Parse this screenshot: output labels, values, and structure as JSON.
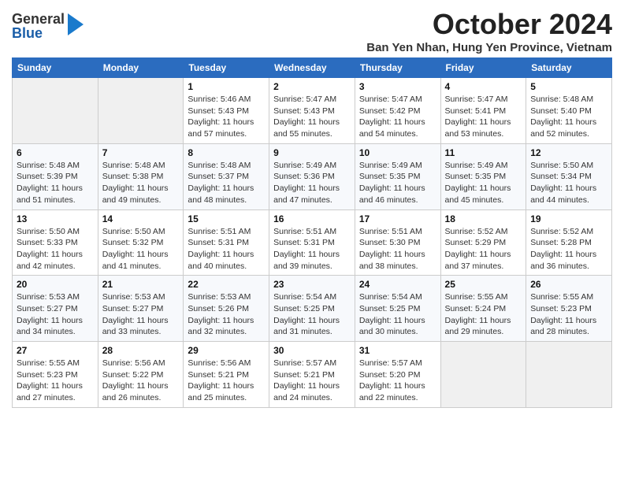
{
  "header": {
    "logo_general": "General",
    "logo_blue": "Blue",
    "month_title": "October 2024",
    "location": "Ban Yen Nhan, Hung Yen Province, Vietnam"
  },
  "days_of_week": [
    "Sunday",
    "Monday",
    "Tuesday",
    "Wednesday",
    "Thursday",
    "Friday",
    "Saturday"
  ],
  "weeks": [
    [
      {
        "day": "",
        "info": ""
      },
      {
        "day": "",
        "info": ""
      },
      {
        "day": "1",
        "sunrise": "5:46 AM",
        "sunset": "5:43 PM",
        "daylight": "11 hours and 57 minutes."
      },
      {
        "day": "2",
        "sunrise": "5:47 AM",
        "sunset": "5:43 PM",
        "daylight": "11 hours and 55 minutes."
      },
      {
        "day": "3",
        "sunrise": "5:47 AM",
        "sunset": "5:42 PM",
        "daylight": "11 hours and 54 minutes."
      },
      {
        "day": "4",
        "sunrise": "5:47 AM",
        "sunset": "5:41 PM",
        "daylight": "11 hours and 53 minutes."
      },
      {
        "day": "5",
        "sunrise": "5:48 AM",
        "sunset": "5:40 PM",
        "daylight": "11 hours and 52 minutes."
      }
    ],
    [
      {
        "day": "6",
        "sunrise": "5:48 AM",
        "sunset": "5:39 PM",
        "daylight": "11 hours and 51 minutes."
      },
      {
        "day": "7",
        "sunrise": "5:48 AM",
        "sunset": "5:38 PM",
        "daylight": "11 hours and 49 minutes."
      },
      {
        "day": "8",
        "sunrise": "5:48 AM",
        "sunset": "5:37 PM",
        "daylight": "11 hours and 48 minutes."
      },
      {
        "day": "9",
        "sunrise": "5:49 AM",
        "sunset": "5:36 PM",
        "daylight": "11 hours and 47 minutes."
      },
      {
        "day": "10",
        "sunrise": "5:49 AM",
        "sunset": "5:35 PM",
        "daylight": "11 hours and 46 minutes."
      },
      {
        "day": "11",
        "sunrise": "5:49 AM",
        "sunset": "5:35 PM",
        "daylight": "11 hours and 45 minutes."
      },
      {
        "day": "12",
        "sunrise": "5:50 AM",
        "sunset": "5:34 PM",
        "daylight": "11 hours and 44 minutes."
      }
    ],
    [
      {
        "day": "13",
        "sunrise": "5:50 AM",
        "sunset": "5:33 PM",
        "daylight": "11 hours and 42 minutes."
      },
      {
        "day": "14",
        "sunrise": "5:50 AM",
        "sunset": "5:32 PM",
        "daylight": "11 hours and 41 minutes."
      },
      {
        "day": "15",
        "sunrise": "5:51 AM",
        "sunset": "5:31 PM",
        "daylight": "11 hours and 40 minutes."
      },
      {
        "day": "16",
        "sunrise": "5:51 AM",
        "sunset": "5:31 PM",
        "daylight": "11 hours and 39 minutes."
      },
      {
        "day": "17",
        "sunrise": "5:51 AM",
        "sunset": "5:30 PM",
        "daylight": "11 hours and 38 minutes."
      },
      {
        "day": "18",
        "sunrise": "5:52 AM",
        "sunset": "5:29 PM",
        "daylight": "11 hours and 37 minutes."
      },
      {
        "day": "19",
        "sunrise": "5:52 AM",
        "sunset": "5:28 PM",
        "daylight": "11 hours and 36 minutes."
      }
    ],
    [
      {
        "day": "20",
        "sunrise": "5:53 AM",
        "sunset": "5:27 PM",
        "daylight": "11 hours and 34 minutes."
      },
      {
        "day": "21",
        "sunrise": "5:53 AM",
        "sunset": "5:27 PM",
        "daylight": "11 hours and 33 minutes."
      },
      {
        "day": "22",
        "sunrise": "5:53 AM",
        "sunset": "5:26 PM",
        "daylight": "11 hours and 32 minutes."
      },
      {
        "day": "23",
        "sunrise": "5:54 AM",
        "sunset": "5:25 PM",
        "daylight": "11 hours and 31 minutes."
      },
      {
        "day": "24",
        "sunrise": "5:54 AM",
        "sunset": "5:25 PM",
        "daylight": "11 hours and 30 minutes."
      },
      {
        "day": "25",
        "sunrise": "5:55 AM",
        "sunset": "5:24 PM",
        "daylight": "11 hours and 29 minutes."
      },
      {
        "day": "26",
        "sunrise": "5:55 AM",
        "sunset": "5:23 PM",
        "daylight": "11 hours and 28 minutes."
      }
    ],
    [
      {
        "day": "27",
        "sunrise": "5:55 AM",
        "sunset": "5:23 PM",
        "daylight": "11 hours and 27 minutes."
      },
      {
        "day": "28",
        "sunrise": "5:56 AM",
        "sunset": "5:22 PM",
        "daylight": "11 hours and 26 minutes."
      },
      {
        "day": "29",
        "sunrise": "5:56 AM",
        "sunset": "5:21 PM",
        "daylight": "11 hours and 25 minutes."
      },
      {
        "day": "30",
        "sunrise": "5:57 AM",
        "sunset": "5:21 PM",
        "daylight": "11 hours and 24 minutes."
      },
      {
        "day": "31",
        "sunrise": "5:57 AM",
        "sunset": "5:20 PM",
        "daylight": "11 hours and 22 minutes."
      },
      {
        "day": "",
        "info": ""
      },
      {
        "day": "",
        "info": ""
      }
    ]
  ]
}
